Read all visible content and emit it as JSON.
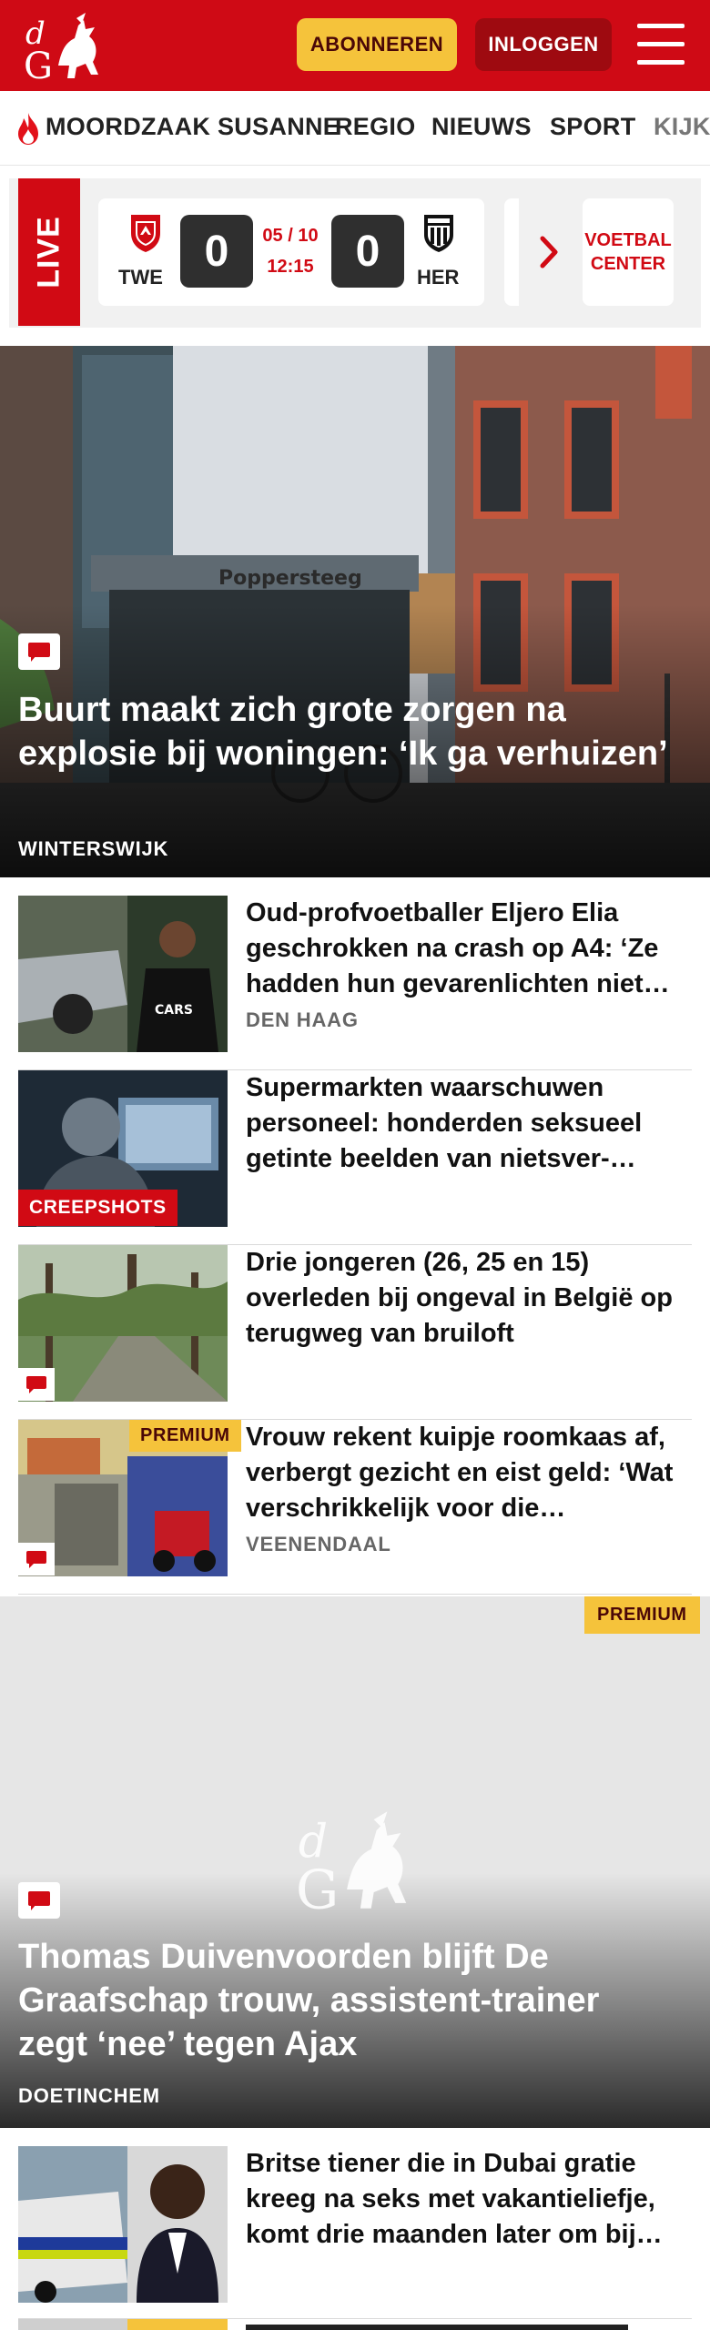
{
  "header": {
    "logo_text": "dG",
    "subscribe_label": "ABONNEREN",
    "login_label": "INLOGGEN",
    "brand_color": "#cf0a15",
    "accent_color": "#f5c33b"
  },
  "nav": {
    "items": [
      {
        "label": "MOORDZAAK SUSANNE",
        "icon": "flame-icon"
      },
      {
        "label": "REGIO"
      },
      {
        "label": "NIEUWS"
      },
      {
        "label": "SPORT"
      },
      {
        "label": "KIJK"
      }
    ]
  },
  "live": {
    "label": "LIVE",
    "match": {
      "home": "TWE",
      "away": "HER",
      "home_score": "0",
      "away_score": "0",
      "date": "05 / 10",
      "time": "12:15"
    },
    "voetbal_center_label": "VOETBAL CENTER"
  },
  "hero": {
    "title": "Buurt maakt zich grote zorgen na explosie bij woningen: ‘Ik ga verhuizen’",
    "location": "WINTERSWIJK",
    "building_sign": "Poppersteeg"
  },
  "articles": [
    {
      "title": "Oud-profvoetballer Eljero Elia geschrokken na crash op A4: ‘Ze hadden hun gevarenlichten niet…",
      "location": "DEN HAAG",
      "tag": "",
      "comment_icon": false
    },
    {
      "title": "Supermarkten waarschuwen personeel: honderden seksueel getinte beelden van nietsver-…",
      "location": "",
      "tag": "CREEPSHOTS",
      "comment_icon": false
    },
    {
      "title": "Drie jongeren (26, 25 en 15) overleden bij ongeval in België op terugweg van bruiloft",
      "location": "",
      "tag": "",
      "comment_icon": true
    },
    {
      "title": "Vrouw rekent kuipje roomkaas af, verbergt gezicht en eist geld: ‘Wat verschrikkelijk voor die…",
      "location": "VEENENDAAL",
      "tag": "PREMIUM",
      "comment_icon": true
    }
  ],
  "hero2": {
    "premium_label": "PREMIUM",
    "title": "Thomas Duivenvoorden blijft De Graafschap trouw, assistent-trainer zegt ‘nee’ tegen Ajax",
    "location": "DOETINCHEM"
  },
  "last_article": {
    "title": "Britse tiener die in Dubai gratie kreeg na seks met vakantieliefje, komt drie maanden later om bij…"
  }
}
